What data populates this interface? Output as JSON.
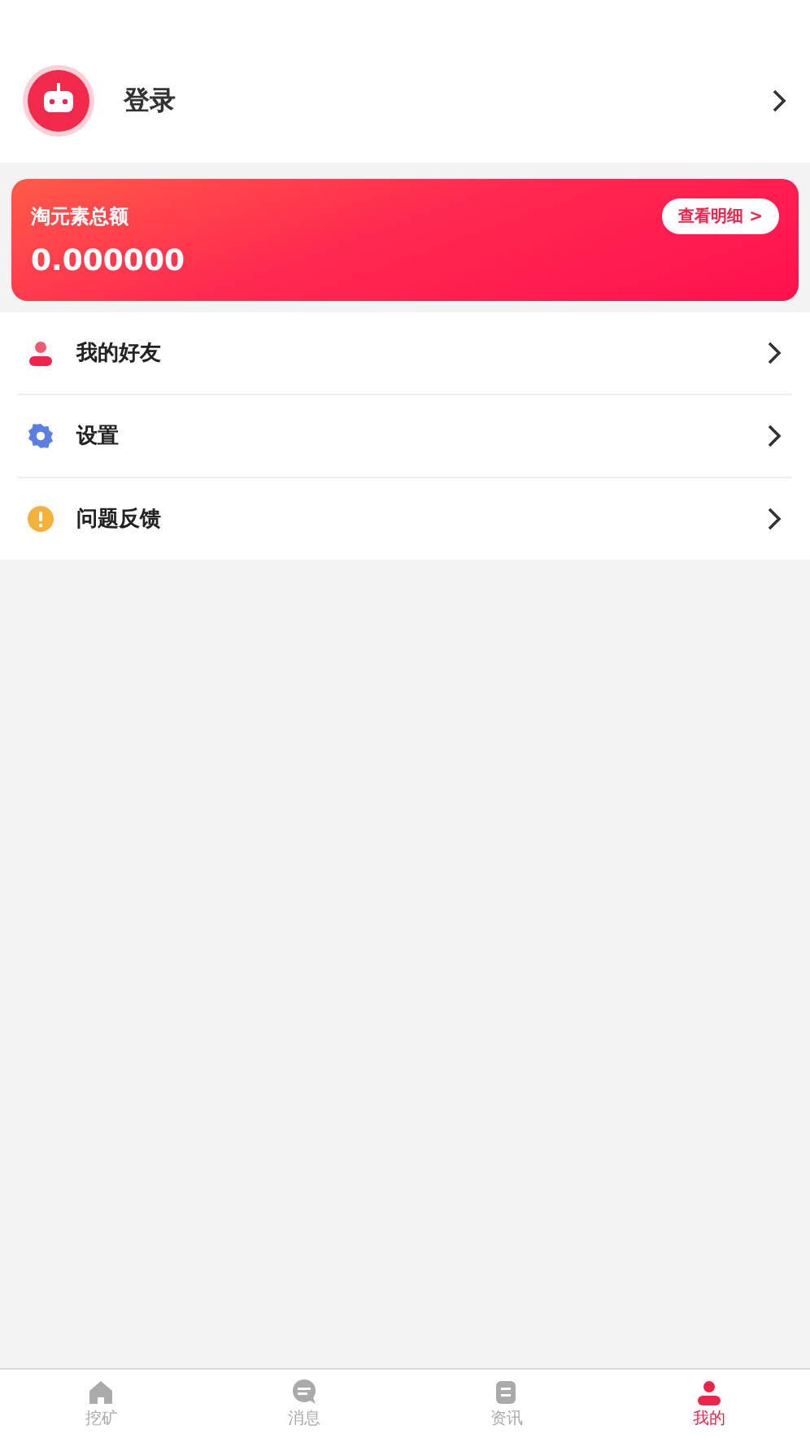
{
  "profile": {
    "login_label": "登录"
  },
  "balance_card": {
    "title": "淘元素总额",
    "amount": "0.000000",
    "details_button": "查看明细 >"
  },
  "menu": [
    {
      "kind": "friends",
      "label": "我的好友"
    },
    {
      "kind": "settings",
      "label": "设置"
    },
    {
      "kind": "feedback",
      "label": "问题反馈"
    }
  ],
  "tab_bar": [
    {
      "kind": "home",
      "label": "挖矿",
      "selected": false
    },
    {
      "kind": "chat",
      "label": "消息",
      "selected": false
    },
    {
      "kind": "news",
      "label": "资讯",
      "selected": false
    },
    {
      "kind": "user",
      "label": "我的",
      "selected": true
    }
  ]
}
